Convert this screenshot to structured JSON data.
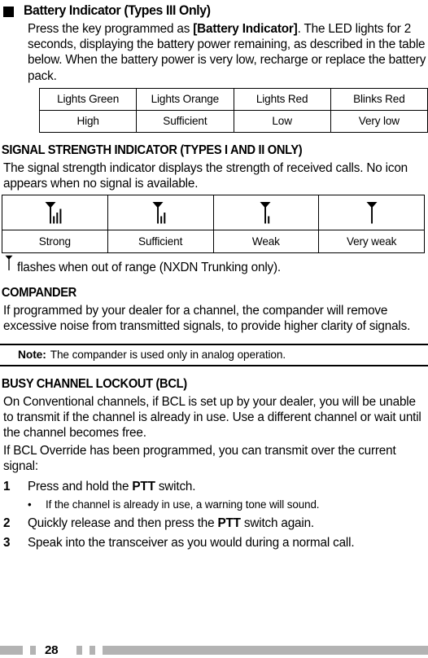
{
  "section_battery": {
    "heading": "Battery Indicator (Types III Only)",
    "paragraph_parts": [
      "Press the key programmed as ",
      "[Battery Indicator]",
      ".  The LED lights for 2 seconds, displaying the battery power remaining, as described in the table below. When the battery power is very low, recharge or replace the battery pack."
    ],
    "table": {
      "headers": [
        "Lights Green",
        "Lights Orange",
        "Lights Red",
        "Blinks Red"
      ],
      "values": [
        "High",
        "Sufficient",
        "Low",
        "Very low"
      ]
    }
  },
  "section_signal": {
    "heading": "SIGNAL STRENGTH INDICATOR (TYPES I AND II ONLY)",
    "paragraph": "The signal strength indicator displays the strength of received calls.  No icon appears when no signal is available.",
    "table": {
      "icons": [
        "antenna-3-bars-icon",
        "antenna-2-bars-icon",
        "antenna-1-bar-icon",
        "antenna-0-bars-icon"
      ],
      "bars": [
        3,
        2,
        1,
        0
      ],
      "labels": [
        "Strong",
        "Sufficient",
        "Weak",
        "Very weak"
      ]
    },
    "out_of_range_icon": "antenna-0-bars-icon",
    "out_of_range_text": "flashes when out of range (NXDN Trunking only)."
  },
  "section_compander": {
    "heading": "COMPANDER",
    "paragraph": "If programmed by your dealer for a channel, the compander will remove excessive noise from transmitted signals, to provide higher clarity of signals.",
    "note_label": "Note:",
    "note_text": "The compander is used only in analog operation."
  },
  "section_bcl": {
    "heading": "BUSY CHANNEL LOCKOUT (BCL)",
    "paragraph_1": "On Conventional channels, if BCL is set up by your dealer, you will be unable to transmit if the channel is already in use.  Use a different channel or wait until the channel becomes free.",
    "paragraph_2": "If BCL Override has been programmed, you can transmit over the current signal:",
    "steps": [
      {
        "num": "1",
        "parts": [
          "Press and hold the ",
          "PTT",
          " switch."
        ],
        "subbullet": {
          "dot": "•",
          "text": "If the channel is already in use, a warning tone will sound."
        }
      },
      {
        "num": "2",
        "parts": [
          "Quickly release and then press the ",
          "PTT",
          " switch again."
        ]
      },
      {
        "num": "3",
        "parts": [
          "Speak into the transceiver as you would during a normal call.",
          "",
          ""
        ]
      }
    ]
  },
  "footer": {
    "page_number": "28",
    "bar_color": "#b3b3b3"
  }
}
